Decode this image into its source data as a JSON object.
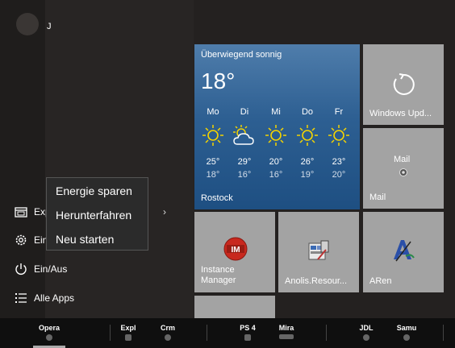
{
  "user": {
    "initial": "J"
  },
  "left_menu": {
    "explorer_label": "Expl",
    "settings_label": "Ein",
    "power_label": "Ein/Aus",
    "all_apps_label": "Alle Apps",
    "chevron": "›"
  },
  "power_menu": {
    "items": [
      "Energie sparen",
      "Herunterfahren",
      "Neu starten"
    ]
  },
  "weather": {
    "condition": "Überwiegend sonnig",
    "temperature": "18°",
    "city": "Rostock",
    "days": [
      {
        "name": "Mo",
        "high": "25°",
        "low": "18°",
        "icon": "sun-icon"
      },
      {
        "name": "Di",
        "high": "29°",
        "low": "16°",
        "icon": "sun-cloud-icon"
      },
      {
        "name": "Mi",
        "high": "20°",
        "low": "16°",
        "icon": "sun-icon"
      },
      {
        "name": "Do",
        "high": "26°",
        "low": "19°",
        "icon": "sun-icon"
      },
      {
        "name": "Fr",
        "high": "23°",
        "low": "20°",
        "icon": "sun-icon"
      }
    ]
  },
  "tiles": {
    "windows_update": "Windows Upd...",
    "mail_center": "Mail",
    "mail_label": "Mail",
    "instance_manager": "Instance Manager",
    "instance_logo": "IM",
    "anolis": "Anolis.Resour...",
    "aren": "ARen"
  },
  "taskbar": {
    "items": [
      "Opera",
      "Expl",
      "Crm",
      "PS 4",
      "Mira",
      "JDL",
      "Samu"
    ]
  },
  "colors": {
    "tile_gray": "#a3a3a3",
    "weather_top": "#4f7dab",
    "weather_bottom": "#1e4f82",
    "sun_yellow": "#f5d400"
  }
}
